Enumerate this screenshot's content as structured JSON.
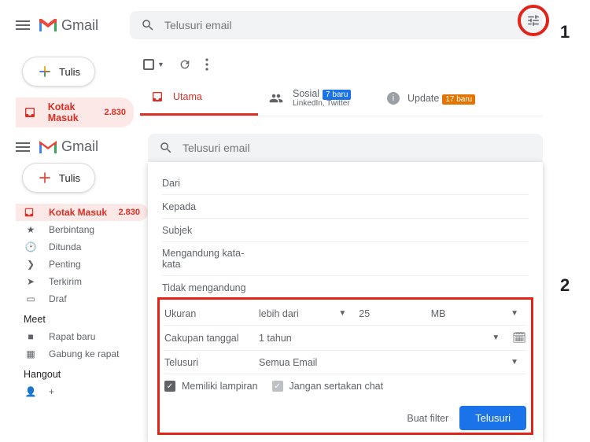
{
  "app_name": "Gmail",
  "callouts": {
    "one": "1",
    "two": "2"
  },
  "search": {
    "placeholder": "Telusuri email"
  },
  "compose": {
    "label": "Tulis"
  },
  "sidebar": {
    "inbox": {
      "label": "Kotak Masuk",
      "count": "2.830"
    },
    "starred": "Berbintang",
    "snoozed": "Ditunda",
    "important": "Penting",
    "sent": "Terkirim",
    "drafts": "Draf"
  },
  "meet": {
    "title": "Meet",
    "new": "Rapat baru",
    "join": "Gabung ke rapat"
  },
  "hangout": {
    "title": "Hangout"
  },
  "tabs": {
    "primary": "Utama",
    "social": {
      "label": "Sosial",
      "badge": "7 baru",
      "sub": "LinkedIn, Twitter"
    },
    "updates": {
      "label": "Update",
      "badge": "17 baru"
    }
  },
  "filter": {
    "from": "Dari",
    "to": "Kepada",
    "subject": "Subjek",
    "has_words": "Mengandung kata-kata",
    "not_has": "Tidak mengandung",
    "size": {
      "label": "Ukuran",
      "op": "lebih dari",
      "value": "25",
      "unit": "MB"
    },
    "date": {
      "label": "Cakupan tanggal",
      "value": "1 tahun"
    },
    "search_in": {
      "label": "Telusuri",
      "value": "Semua Email"
    },
    "has_attach": "Memiliki lampiran",
    "no_chat": "Jangan sertakan chat",
    "create_filter": "Buat filter",
    "search_btn": "Telusuri"
  }
}
